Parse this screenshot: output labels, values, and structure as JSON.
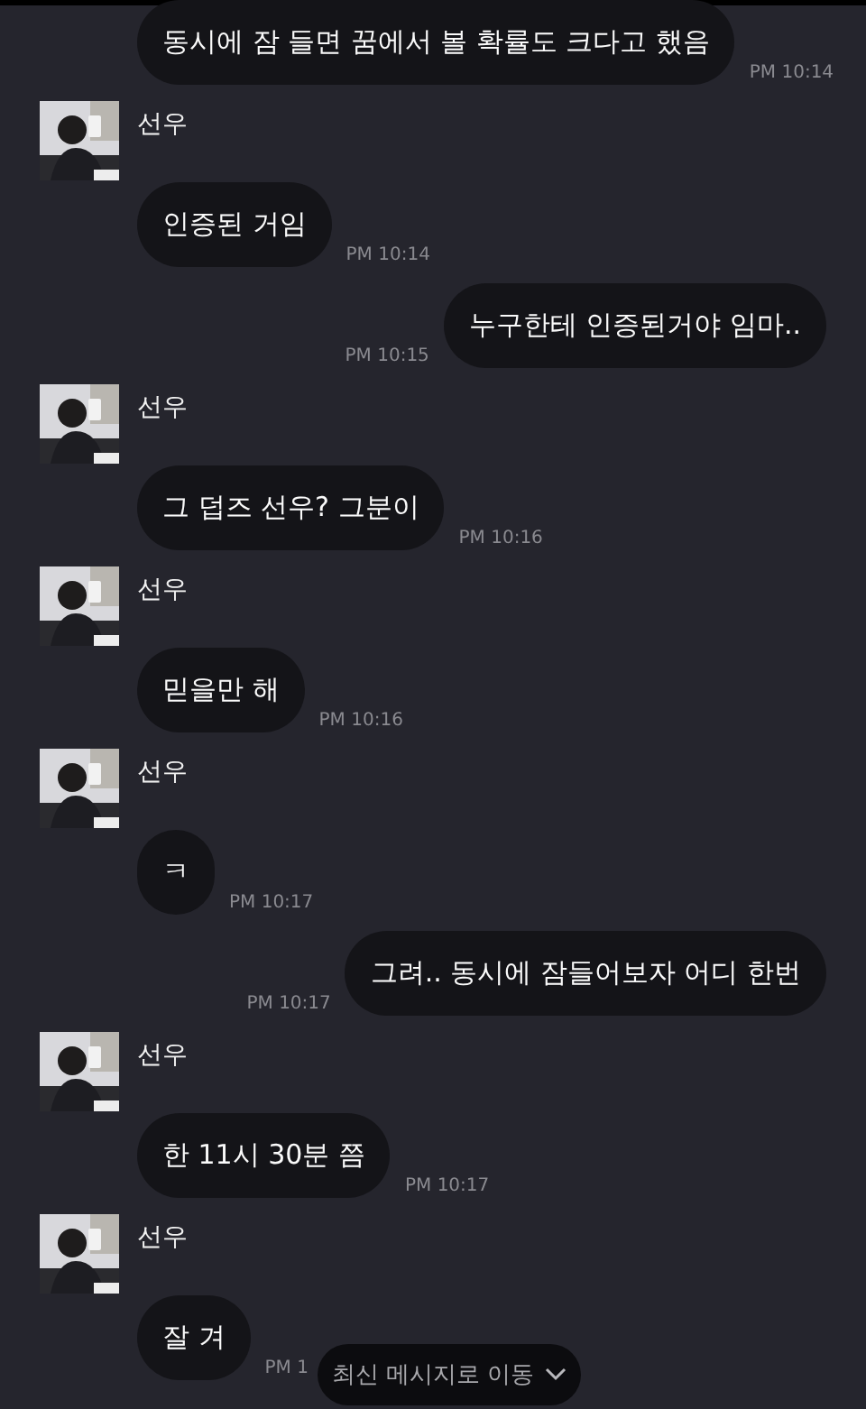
{
  "messages": [
    {
      "kind": "received",
      "text": "동시에 잠 들면 꿈에서 볼 확률도 크다고 했음",
      "time": "PM 10:14"
    },
    {
      "kind": "received",
      "sender": "선우",
      "text": "인증된 거임",
      "time": "PM 10:14"
    },
    {
      "kind": "sent",
      "text": "누구한테 인증된거야 임마..",
      "time": "PM 10:15"
    },
    {
      "kind": "received",
      "sender": "선우",
      "text": "그 덥즈 선우? 그분이",
      "time": "PM 10:16"
    },
    {
      "kind": "received",
      "sender": "선우",
      "text": "믿을만 해",
      "time": "PM 10:16"
    },
    {
      "kind": "received",
      "sender": "선우",
      "text": "ㅋ",
      "time": "PM 10:17"
    },
    {
      "kind": "sent",
      "text": "그려.. 동시에 잠들어보자 어디 한번",
      "time": "PM 10:17"
    },
    {
      "kind": "received",
      "sender": "선우",
      "text": "한 11시 30분 쯤",
      "time": "PM 10:17"
    },
    {
      "kind": "received",
      "sender": "선우",
      "text": "잘 겨",
      "time": "PM 1"
    }
  ],
  "jump_button": {
    "label": "최신 메시지로 이동"
  }
}
